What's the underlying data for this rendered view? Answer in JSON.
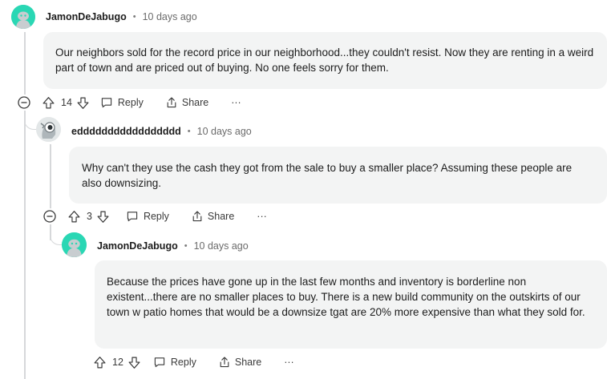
{
  "comments": [
    {
      "author": "JamonDeJabugo",
      "time": "10 days ago",
      "body": "Our neighbors sold for the record price in our neighborhood...they couldn't resist. Now they are renting in a weird part of town and are priced out of buying. No one feels sorry for them.",
      "votes": "14",
      "reply_label": "Reply",
      "share_label": "Share",
      "more_label": "···"
    },
    {
      "author": "eddddddddddddddddd",
      "time": "10 days ago",
      "body": "Why can't they use the cash they got from the sale to buy a smaller place? Assuming these people are also downsizing.",
      "votes": "3",
      "reply_label": "Reply",
      "share_label": "Share",
      "more_label": "···"
    },
    {
      "author": "JamonDeJabugo",
      "time": "10 days ago",
      "body": "Because the prices have gone up in the last few months and inventory is borderline non existent...there are no smaller places to buy. There is a new build community on the outskirts of our town w patio homes that would be a downsize tgat are 20% more expensive than what they sold for.",
      "votes": "12",
      "reply_label": "Reply",
      "share_label": "Share",
      "more_label": "···"
    }
  ],
  "separator": "•",
  "colors": {
    "avatar_teal": "#2ad7b4",
    "bubble_bg": "#f3f4f4",
    "thread_line": "#d6d8da"
  }
}
